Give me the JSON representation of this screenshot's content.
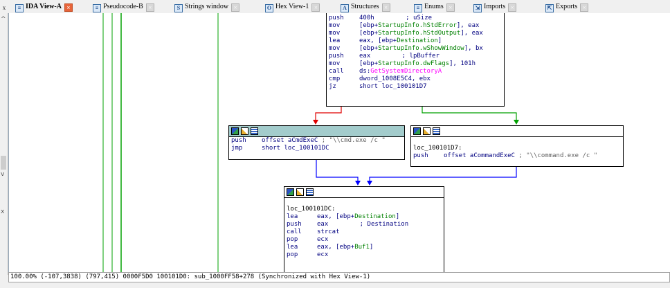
{
  "tabs": [
    {
      "label": "IDA View-A",
      "icon": "ida-view-icon",
      "active": true
    },
    {
      "label": "Pseudocode-B",
      "icon": "pseudocode-icon"
    },
    {
      "label": "Strings window",
      "icon": "strings-icon"
    },
    {
      "label": "Hex View-1",
      "icon": "hex-view-icon"
    },
    {
      "label": "Structures",
      "icon": "structures-icon"
    },
    {
      "label": "Enums",
      "icon": "enums-icon"
    },
    {
      "label": "Imports",
      "icon": "imports-icon"
    },
    {
      "label": "Exports",
      "icon": "exports-icon"
    }
  ],
  "top_block": [
    {
      "m": "push",
      "o": "400h",
      "c": "; uSize"
    },
    {
      "m": "mov",
      "o": "[ebp+StartupInfo.hStdError], eax"
    },
    {
      "m": "mov",
      "o": "[ebp+StartupInfo.hStdOutput], eax"
    },
    {
      "m": "lea",
      "o": "eax, [ebp+Destination]"
    },
    {
      "m": "mov",
      "o": "[ebp+StartupInfo.wShowWindow], bx"
    },
    {
      "m": "push",
      "o": "eax",
      "c": "; lpBuffer"
    },
    {
      "m": "mov",
      "o": "[ebp+StartupInfo.dwFlags], 101h"
    },
    {
      "m": "call",
      "o": "ds:GetSystemDirectoryA"
    },
    {
      "m": "cmp",
      "o": "dword_1008E5C4, ebx"
    },
    {
      "m": "jz",
      "o": "short loc_100101D7"
    }
  ],
  "left_block": [
    {
      "m": "push",
      "o": "offset aCmdExeC",
      "c": "; \"\\\\cmd.exe /c \""
    },
    {
      "m": "jmp",
      "o": "short loc_100101DC"
    }
  ],
  "right_block": {
    "label": "loc_100101D7:",
    "lines": [
      {
        "m": "push",
        "o": "offset aCommandExeC",
        "c": "; \"\\\\command.exe /c \""
      }
    ]
  },
  "bottom_block": {
    "label": "loc_100101DC:",
    "lines": [
      {
        "m": "lea",
        "o": "eax, [ebp+Destination]"
      },
      {
        "m": "push",
        "o": "eax",
        "c": "; Destination"
      },
      {
        "m": "call",
        "o": "strcat"
      },
      {
        "m": "pop",
        "o": "ecx"
      },
      {
        "m": "lea",
        "o": "eax, [ebp+Buf1]"
      },
      {
        "m": "pop",
        "o": "ecx"
      }
    ]
  },
  "status_text": "100.00% (-107,3838) (797,415) 0000F5D0 100101D0: sub_1000FF58+278 (Synchronized with Hex View-1)",
  "colors": {
    "true_edge": "#00a000",
    "false_edge": "#e00000",
    "jump_edge": "#0000ff",
    "selected_header": "#a3cccc"
  }
}
